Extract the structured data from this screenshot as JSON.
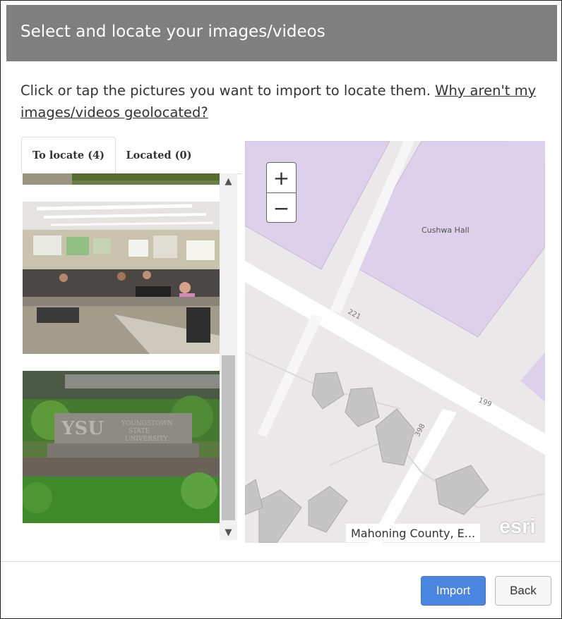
{
  "dialog": {
    "title": "Select and locate your images/videos",
    "instruction_text": "Click or tap the pictures you want to import to locate them. ",
    "instruction_link": "Why aren't my images/videos geolocated?"
  },
  "tabs": [
    {
      "label": "To locate (4)",
      "active": true
    },
    {
      "label": "Located (0)",
      "active": false
    }
  ],
  "photos": [
    {
      "description": "computer-lab-photo"
    },
    {
      "description": "youngstown-state-sign-photo"
    }
  ],
  "map": {
    "zoom_in": "+",
    "zoom_out": "−",
    "building_label": "Cushwa Hall",
    "road_labels": [
      "221",
      "199",
      "398"
    ],
    "attribution": "Mahoning County, E...",
    "logo": "esri"
  },
  "sign_text": {
    "logo": "YSU",
    "line1": "YOUNGSTOWN",
    "line2": "STATE",
    "line3": "UNIVERSITY"
  },
  "buttons": {
    "import": "Import",
    "back": "Back"
  },
  "colors": {
    "header_bg": "#7f7f7f",
    "primary": "#4a86df",
    "building": "#ddd0ea"
  }
}
